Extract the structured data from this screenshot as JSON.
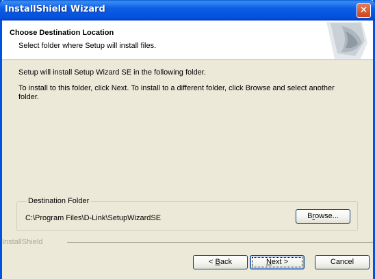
{
  "window": {
    "title": "InstallShield Wizard",
    "close_symbol": "✕"
  },
  "header": {
    "title": "Choose Destination Location",
    "subtitle": "Select folder where Setup will install files."
  },
  "body": {
    "line1": "Setup will install Setup Wizard SE in the following folder.",
    "line2": "To install to this folder, click Next. To install to a different folder, click Browse and select another folder."
  },
  "destination": {
    "label": "Destination Folder",
    "path": "C:\\Program Files\\D-Link\\SetupWizardSE",
    "browse_pre": "B",
    "browse_ul": "r",
    "browse_post": "owse..."
  },
  "footer": {
    "brand": "InstallShield",
    "back_pre": "< ",
    "back_ul": "B",
    "back_post": "ack",
    "next_ul": "N",
    "next_post": "ext >",
    "cancel": "Cancel"
  },
  "colors": {
    "titlebar": "#0553dc",
    "face": "#ece9d8"
  }
}
